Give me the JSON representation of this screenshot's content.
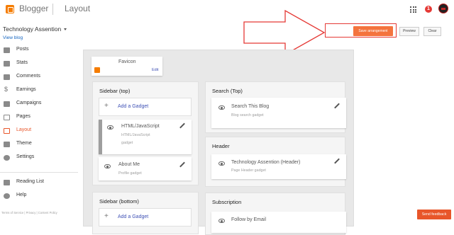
{
  "header": {
    "app_name": "Blogger",
    "page_title": "Layout",
    "notification_count": "1"
  },
  "blog": {
    "title": "Technology Assention",
    "view_blog": "View blog"
  },
  "actions": {
    "save": "Save arrangement",
    "preview": "Preview",
    "clear": "Clear"
  },
  "sidebar": {
    "items": [
      {
        "label": "Posts",
        "icon": "posts-icon"
      },
      {
        "label": "Stats",
        "icon": "stats-icon"
      },
      {
        "label": "Comments",
        "icon": "comments-icon"
      },
      {
        "label": "Earnings",
        "icon": "dollar-icon"
      },
      {
        "label": "Campaigns",
        "icon": "campaigns-icon"
      },
      {
        "label": "Pages",
        "icon": "pages-icon"
      },
      {
        "label": "Layout",
        "icon": "layout-icon",
        "active": true
      },
      {
        "label": "Theme",
        "icon": "theme-icon"
      },
      {
        "label": "Settings",
        "icon": "gear-icon"
      }
    ],
    "secondary": [
      {
        "label": "Reading List",
        "icon": "bookmark-icon"
      },
      {
        "label": "Help",
        "icon": "help-icon"
      }
    ],
    "footer": "Terms of Service  |  Privacy  |  Content Policy"
  },
  "layout": {
    "favicon": {
      "title": "Favicon",
      "edit": "Edit"
    },
    "sidebar_top": {
      "title": "Sidebar (top)",
      "add_gadget": "Add a Gadget",
      "gadgets": [
        {
          "title": "HTML/JavaScript",
          "sub1": "HTML/JavaScript",
          "sub2": "gadget"
        },
        {
          "title": "About Me",
          "sub1": "Profile gadget"
        }
      ]
    },
    "sidebar_bottom": {
      "title": "Sidebar (bottom)",
      "add_gadget": "Add a Gadget"
    },
    "search_top": {
      "title": "Search (Top)",
      "gadget": {
        "title": "Search This Blog",
        "sub": "Blog search gadget"
      }
    },
    "header_section": {
      "title": "Header",
      "gadget": {
        "title": "Technology Assention (Header)",
        "sub": "Page Header gadget"
      }
    },
    "subscription": {
      "title": "Subscription",
      "gadget": {
        "title": "Follow by Email"
      }
    }
  },
  "feedback": "Send feedback",
  "colors": {
    "accent": "#e8562a",
    "save_button": "#f4733d",
    "annotation": "#e53935",
    "link": "#3f51b5"
  }
}
